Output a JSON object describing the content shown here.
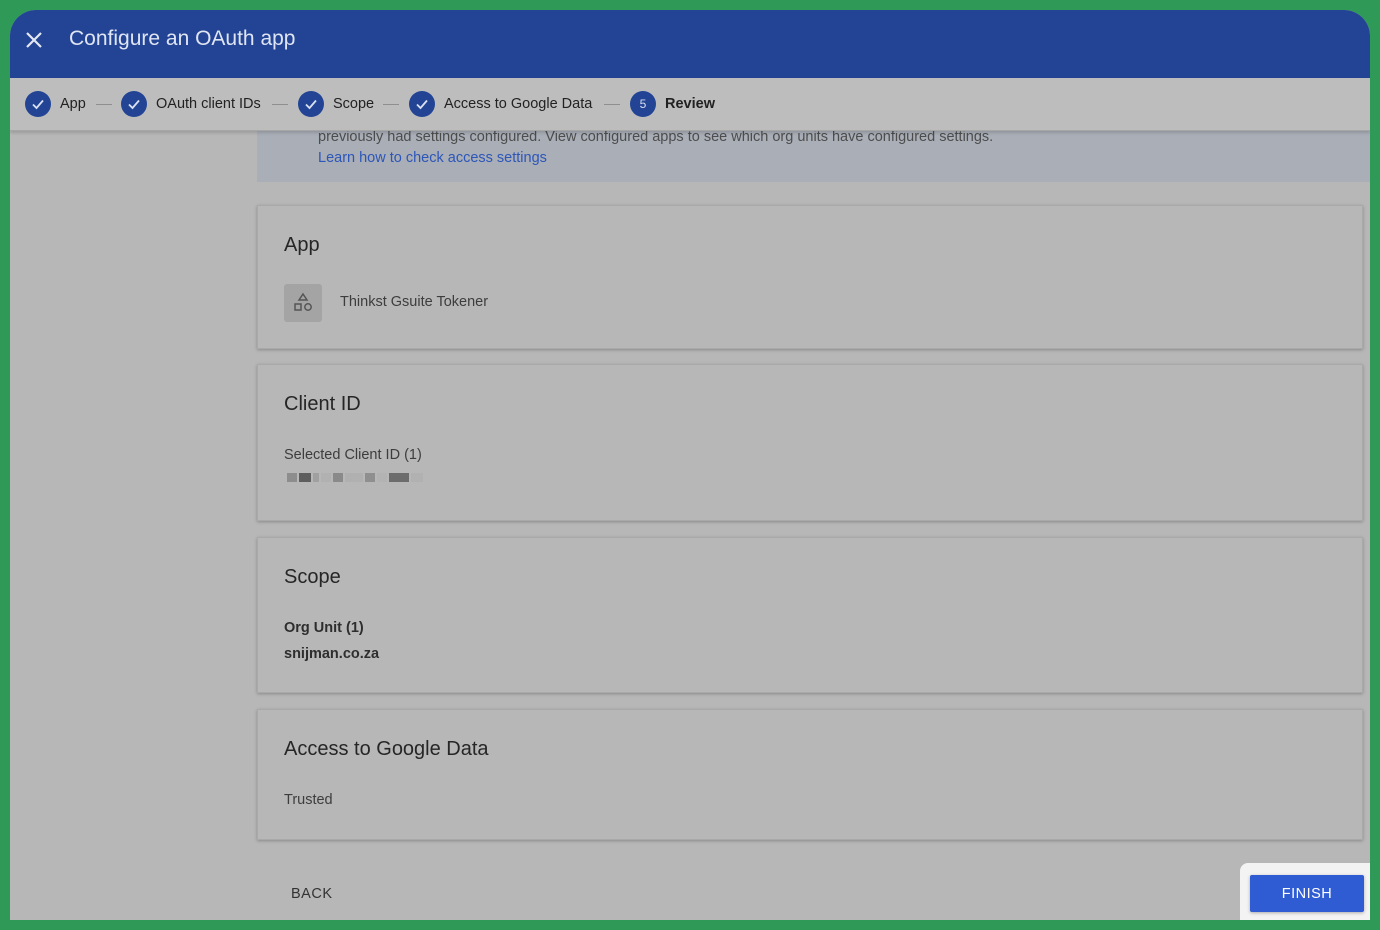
{
  "header": {
    "title": "Configure an OAuth app",
    "close_icon": "close-icon"
  },
  "stepper": {
    "steps": [
      {
        "label": "App",
        "state": "done"
      },
      {
        "label": "OAuth client IDs",
        "state": "done"
      },
      {
        "label": "Scope",
        "state": "done"
      },
      {
        "label": "Access to Google Data",
        "state": "done"
      },
      {
        "label": "Review",
        "state": "current",
        "number": "5"
      }
    ]
  },
  "banner": {
    "text": "previously had settings configured. View configured apps to see which org units have configured settings.",
    "link": "Learn how to check access settings"
  },
  "cards": {
    "app": {
      "heading": "App",
      "app_name": "Thinkst Gsuite Tokener",
      "icon": "app-shapes-icon"
    },
    "client_id": {
      "heading": "Client ID",
      "label": "Selected Client ID (1)"
    },
    "scope": {
      "heading": "Scope",
      "label": "Org Unit (1)",
      "value": "snijman.co.za"
    },
    "access": {
      "heading": "Access to Google Data",
      "value": "Trusted"
    }
  },
  "footer": {
    "back_label": "BACK",
    "finish_label": "FINISH"
  },
  "colors": {
    "header_bg": "#234495",
    "accent": "#2f5bd3",
    "link": "#2d56b8",
    "frame_border": "#2f9a57"
  }
}
